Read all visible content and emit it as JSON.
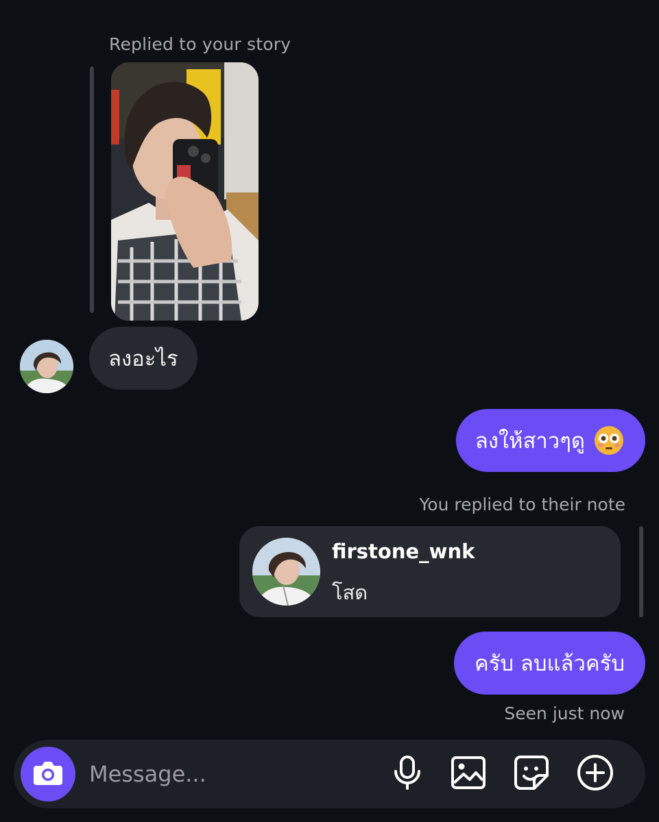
{
  "story_reply": {
    "caption": "Replied to your story"
  },
  "messages": {
    "incoming_1": "ลงอะไร",
    "outgoing_1": "ลงให้สาวๆดู",
    "outgoing_1_emoji": "flushed-face-emoji",
    "note_reply_caption": "You replied to their note",
    "note": {
      "username": "firstone_wnk",
      "text": "โสด"
    },
    "outgoing_2": "ครับ ลบแล้วครับ",
    "seen_status": "Seen just now"
  },
  "composer": {
    "placeholder": "Message...",
    "icons": [
      "camera-icon",
      "microphone-icon",
      "gallery-icon",
      "sticker-icon",
      "add-icon"
    ]
  },
  "colors": {
    "background": "#0c0f14",
    "incoming_bubble": "#26292f",
    "outgoing_bubble": "#6a4df5",
    "secondary_text": "#a7a9ae"
  }
}
